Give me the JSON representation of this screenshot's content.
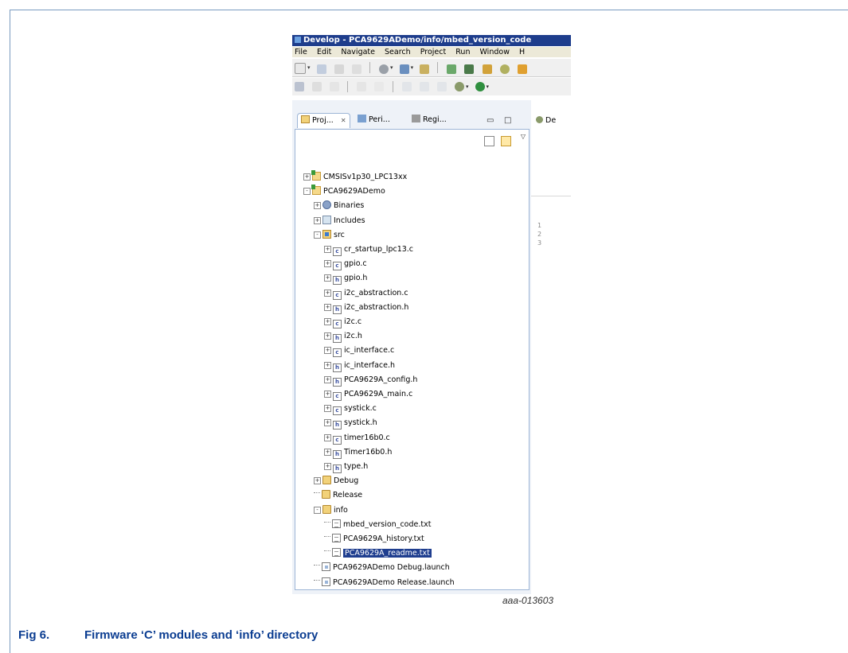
{
  "figure": {
    "caption_number": "Fig 6.",
    "caption_title": "Firmware ‘C’ modules and ‘info’ directory",
    "image_code": "aaa-013603"
  },
  "window": {
    "title": "Develop - PCA9629ADemo/info/mbed_version_code"
  },
  "menu": [
    "File",
    "Edit",
    "Navigate",
    "Search",
    "Project",
    "Run",
    "Window",
    "H"
  ],
  "tabs": [
    {
      "label": "Proj...",
      "close": "✕",
      "icon": "project-explorer-icon"
    },
    {
      "label": "Peri...",
      "icon": "peripherals-icon"
    },
    {
      "label": "Regi...",
      "icon": "registers-icon"
    }
  ],
  "right_tab": {
    "label": "De"
  },
  "gutter_lines": [
    "1",
    "2",
    "3"
  ],
  "tree": [
    {
      "label": "CMSISv1p30_LPC13xx",
      "depth": 0,
      "expander": "+",
      "icon": "project"
    },
    {
      "label": "PCA9629ADemo",
      "depth": 0,
      "expander": "-",
      "icon": "project"
    },
    {
      "label": "Binaries",
      "depth": 1,
      "expander": "+",
      "icon": "binaries"
    },
    {
      "label": "Includes",
      "depth": 1,
      "expander": "+",
      "icon": "includes"
    },
    {
      "label": "src",
      "depth": 1,
      "expander": "-",
      "icon": "source-folder"
    },
    {
      "label": "cr_startup_lpc13.c",
      "depth": 2,
      "expander": "+",
      "icon": "c-file"
    },
    {
      "label": "gpio.c",
      "depth": 2,
      "expander": "+",
      "icon": "c-file"
    },
    {
      "label": "gpio.h",
      "depth": 2,
      "expander": "+",
      "icon": "h-file"
    },
    {
      "label": "i2c_abstraction.c",
      "depth": 2,
      "expander": "+",
      "icon": "c-file"
    },
    {
      "label": "i2c_abstraction.h",
      "depth": 2,
      "expander": "+",
      "icon": "h-file"
    },
    {
      "label": "i2c.c",
      "depth": 2,
      "expander": "+",
      "icon": "c-file"
    },
    {
      "label": "i2c.h",
      "depth": 2,
      "expander": "+",
      "icon": "h-file"
    },
    {
      "label": "ic_interface.c",
      "depth": 2,
      "expander": "+",
      "icon": "c-file"
    },
    {
      "label": "ic_interface.h",
      "depth": 2,
      "expander": "+",
      "icon": "h-file"
    },
    {
      "label": "PCA9629A_config.h",
      "depth": 2,
      "expander": "+",
      "icon": "h-file"
    },
    {
      "label": "PCA9629A_main.c",
      "depth": 2,
      "expander": "+",
      "icon": "c-file"
    },
    {
      "label": "systick.c",
      "depth": 2,
      "expander": "+",
      "icon": "c-file"
    },
    {
      "label": "systick.h",
      "depth": 2,
      "expander": "+",
      "icon": "h-file"
    },
    {
      "label": "timer16b0.c",
      "depth": 2,
      "expander": "+",
      "icon": "c-file"
    },
    {
      "label": "Timer16b0.h",
      "depth": 2,
      "expander": "+",
      "icon": "h-file"
    },
    {
      "label": "type.h",
      "depth": 2,
      "expander": "+",
      "icon": "h-file"
    },
    {
      "label": "Debug",
      "depth": 1,
      "expander": "+",
      "icon": "folder"
    },
    {
      "label": "Release",
      "depth": 1,
      "expander": "",
      "icon": "folder"
    },
    {
      "label": "info",
      "depth": 1,
      "expander": "-",
      "icon": "folder"
    },
    {
      "label": "mbed_version_code.txt",
      "depth": 2,
      "expander": "",
      "icon": "txt-file"
    },
    {
      "label": "PCA9629A_history.txt",
      "depth": 2,
      "expander": "",
      "icon": "txt-file"
    },
    {
      "label": "PCA9629A_readme.txt",
      "depth": 2,
      "expander": "",
      "icon": "txt-file",
      "selected": true
    },
    {
      "label": "PCA9629ADemo Debug.launch",
      "depth": 1,
      "expander": "",
      "icon": "launch-file"
    },
    {
      "label": "PCA9629ADemo Release.launch",
      "depth": 1,
      "expander": "",
      "icon": "launch-file"
    }
  ],
  "colors": {
    "caption": "#0b3d91",
    "titlebar": "#1e3d8c",
    "selection": "#1f3e8f",
    "frame": "#7a9bc0"
  }
}
